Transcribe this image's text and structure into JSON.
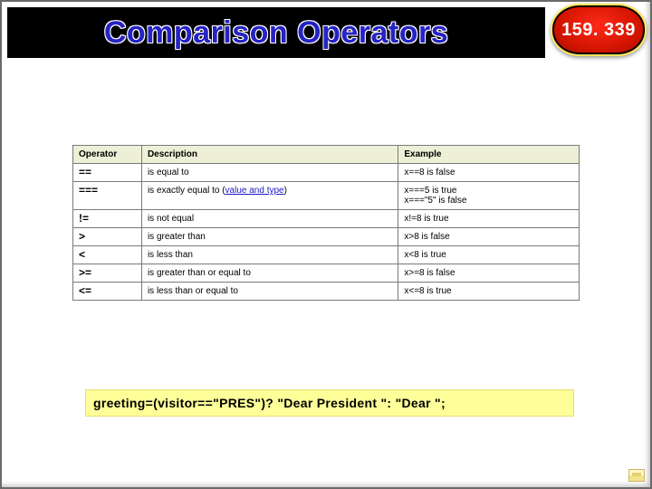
{
  "header": {
    "title": "Comparison Operators",
    "badge": "159. 339"
  },
  "table": {
    "columns": [
      "Operator",
      "Description",
      "Example"
    ],
    "rows": [
      {
        "op": "==",
        "desc_plain": "is equal to",
        "ex": "x==8 is false"
      },
      {
        "op": "===",
        "desc_prefix": "is exactly equal to (",
        "desc_link": "value and type",
        "desc_suffix": ")",
        "ex": "x===5 is true\nx===\"5\" is false"
      },
      {
        "op": "!=",
        "desc_plain": "is not equal",
        "ex": "x!=8 is true"
      },
      {
        "op": ">",
        "desc_plain": "is greater than",
        "ex": "x>8 is false"
      },
      {
        "op": "<",
        "desc_plain": "is less than",
        "ex": "x<8 is true"
      },
      {
        "op": ">=",
        "desc_plain": "is greater than or equal to",
        "ex": "x>=8 is false"
      },
      {
        "op": "<=",
        "desc_plain": "is less than or equal to",
        "ex": "x<=8 is true"
      }
    ]
  },
  "snippet": "greeting=(visitor==\"PRES\")? \"Dear President \": \"Dear \";",
  "chart_data": {
    "type": "table",
    "title": "Comparison Operators",
    "columns": [
      "Operator",
      "Description",
      "Example"
    ],
    "rows": [
      [
        "==",
        "is equal to",
        "x==8 is false"
      ],
      [
        "===",
        "is exactly equal to (value and type)",
        "x===5 is true; x===\"5\" is false"
      ],
      [
        "!=",
        "is not equal",
        "x!=8 is true"
      ],
      [
        ">",
        "is greater than",
        "x>8 is false"
      ],
      [
        "<",
        "is less than",
        "x<8 is true"
      ],
      [
        ">=",
        "is greater than or equal to",
        "x>=8 is false"
      ],
      [
        "<=",
        "is less than or equal to",
        "x<=8 is true"
      ]
    ]
  }
}
